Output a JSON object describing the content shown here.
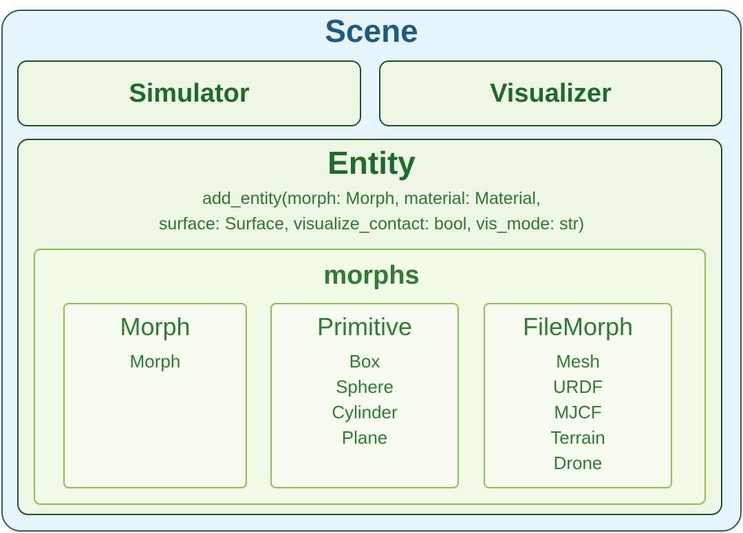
{
  "scene": {
    "title": "Scene",
    "simulator": "Simulator",
    "visualizer": "Visualizer"
  },
  "entity": {
    "title": "Entity",
    "signature_line1": "add_entity(morph: Morph, material: Material,",
    "signature_line2": "surface: Surface, visualize_contact: bool, vis_mode: str)"
  },
  "morphs": {
    "title": "morphs",
    "groups": [
      {
        "title": "Morph",
        "items": [
          "Morph"
        ]
      },
      {
        "title": "Primitive",
        "items": [
          "Box",
          "Sphere",
          "Cylinder",
          "Plane"
        ]
      },
      {
        "title": "FileMorph",
        "items": [
          "Mesh",
          "URDF",
          "MJCF",
          "Terrain",
          "Drone"
        ]
      }
    ]
  },
  "colors": {
    "scene_border": "#2c5a77",
    "scene_fill": "#e6f4fc",
    "scene_title": "#1d5b82",
    "entity_border": "#1e5128",
    "entity_fill": "#eef6e6",
    "morph_border": "#8bc34a",
    "text_green": "#2e7d32"
  }
}
